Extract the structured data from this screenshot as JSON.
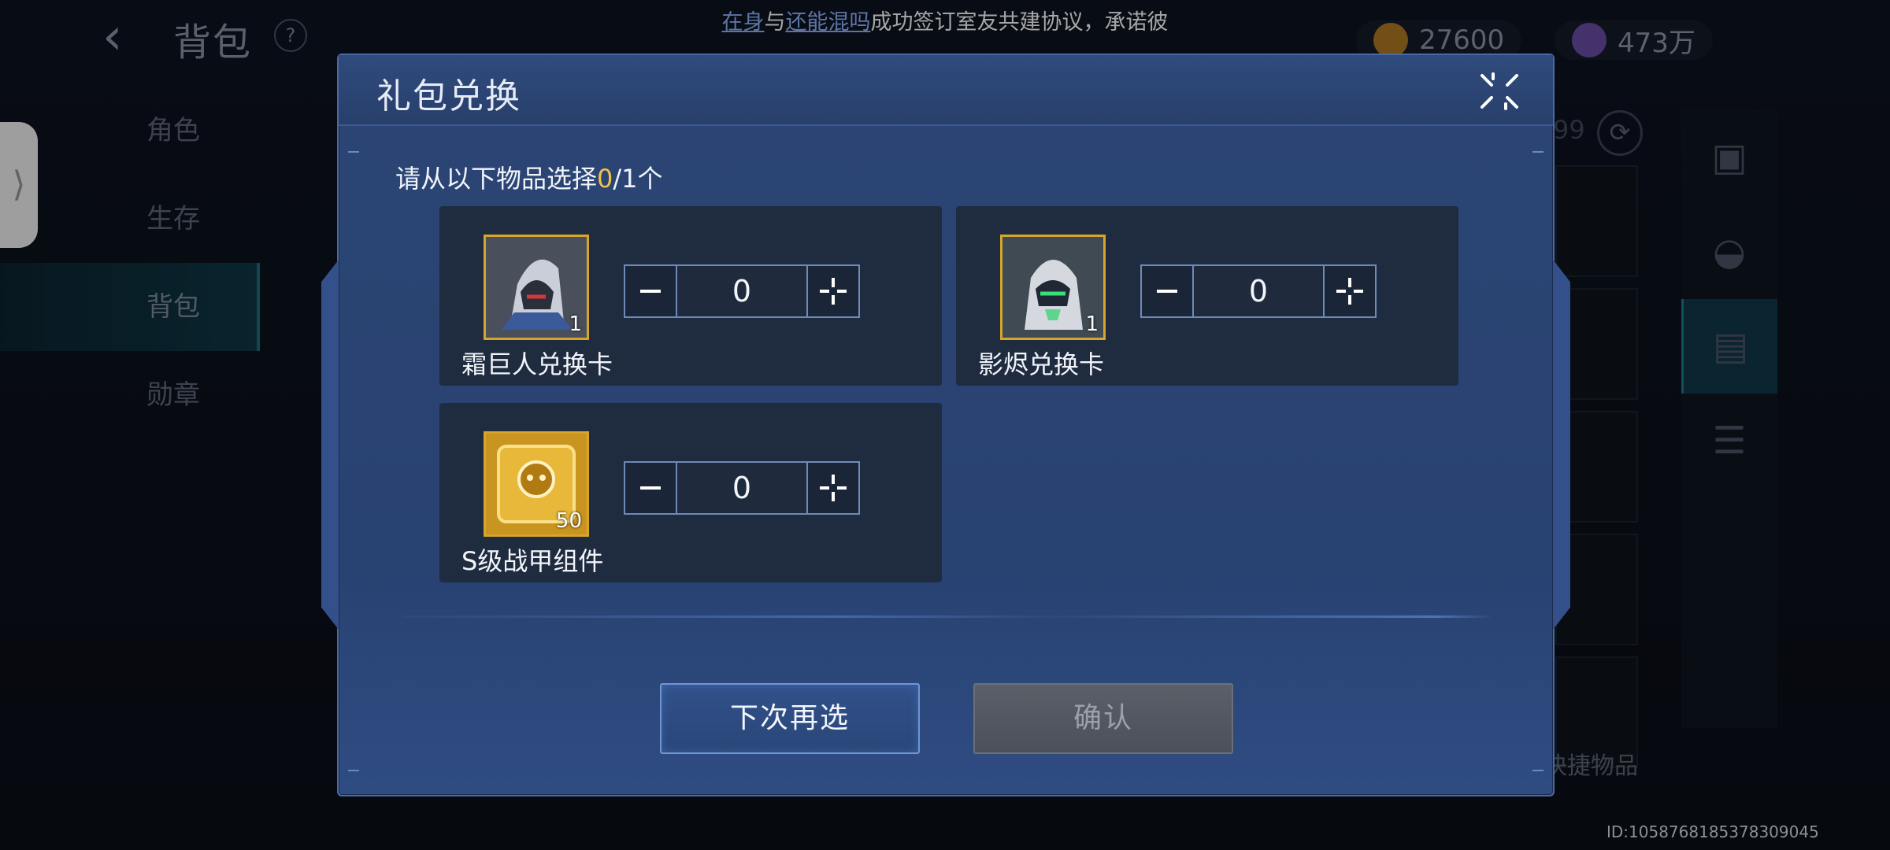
{
  "background": {
    "title": "背包",
    "help": "?",
    "currencies": [
      {
        "icon": "gold-coin-icon",
        "value": "27600",
        "color": "#c08a2a"
      },
      {
        "icon": "gem-icon",
        "value": "473万",
        "color": "#8a6bd0"
      }
    ],
    "nav_items": [
      {
        "label": "角色",
        "active": false
      },
      {
        "label": "生存",
        "active": false
      },
      {
        "label": "背包",
        "active": true
      },
      {
        "label": "勋章",
        "active": false
      }
    ],
    "stray_number": "99",
    "quick_label": "快捷物品",
    "player_id": "ID:1058768185378309045"
  },
  "broadcast": {
    "name1": "在身",
    "sep": "与",
    "name2": "还能混吗",
    "rest": "成功签订室友共建协议，承诺彼"
  },
  "modal": {
    "title": "礼包兑换",
    "instruction_prefix": "请从以下物品选择",
    "selected": "0",
    "instruction_suffix": "/1个",
    "items": [
      {
        "name": "霜巨人兑换卡",
        "count": "1",
        "quantity": "0",
        "icon": "frost-giant-card-icon"
      },
      {
        "name": "影烬兑换卡",
        "count": "1",
        "quantity": "0",
        "icon": "shadow-ember-card-icon"
      },
      {
        "name": "S级战甲组件",
        "count": "50",
        "quantity": "0",
        "icon": "armor-component-icon"
      }
    ],
    "later_button": "下次再选",
    "confirm_button": "确认"
  },
  "colors": {
    "accent_yellow": "#f2c14a",
    "link_blue": "#8fb3ff",
    "modal_bg": "#2b4574"
  }
}
